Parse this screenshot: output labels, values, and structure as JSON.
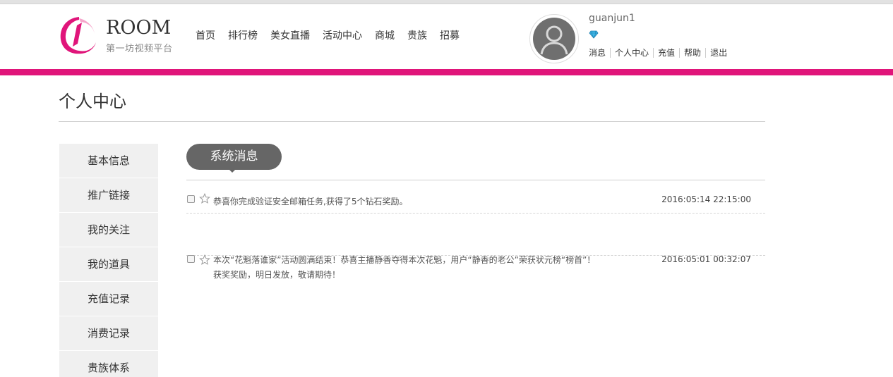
{
  "brand": {
    "name": "ROOM",
    "tagline": "第一坊视频平台",
    "logo_color": "#e0157a"
  },
  "nav": {
    "items": [
      "首页",
      "排行榜",
      "美女直播",
      "活动中心",
      "商城",
      "贵族",
      "招募"
    ]
  },
  "user": {
    "name": "guanjun1",
    "badge_icon": "diamond-icon",
    "links": [
      "消息",
      "个人中心",
      "充值",
      "帮助",
      "退出"
    ]
  },
  "page": {
    "title": "个人中心"
  },
  "sidebar": {
    "items": [
      "基本信息",
      "推广链接",
      "我的关注",
      "我的道具",
      "充值记录",
      "消费记录",
      "贵族体系"
    ]
  },
  "section": {
    "title": "系统消息"
  },
  "messages": [
    {
      "text": "恭喜你完成验证安全邮箱任务,获得了5个钻石奖励。",
      "time": "2016:05:14 22:15:00"
    },
    {
      "text": "本次“花魁落谁家”活动圆满结束！恭喜主播静香夺得本次花魁，用户“静香的老公”荣获状元榜“榜首”！",
      "text_line2": "获奖奖励，明日发放，敬请期待！",
      "time": "2016:05:01 00:32:07"
    }
  ],
  "colors": {
    "accent": "#e0157a",
    "pill": "#666666",
    "sidebar_bg": "#f0f0f0"
  }
}
